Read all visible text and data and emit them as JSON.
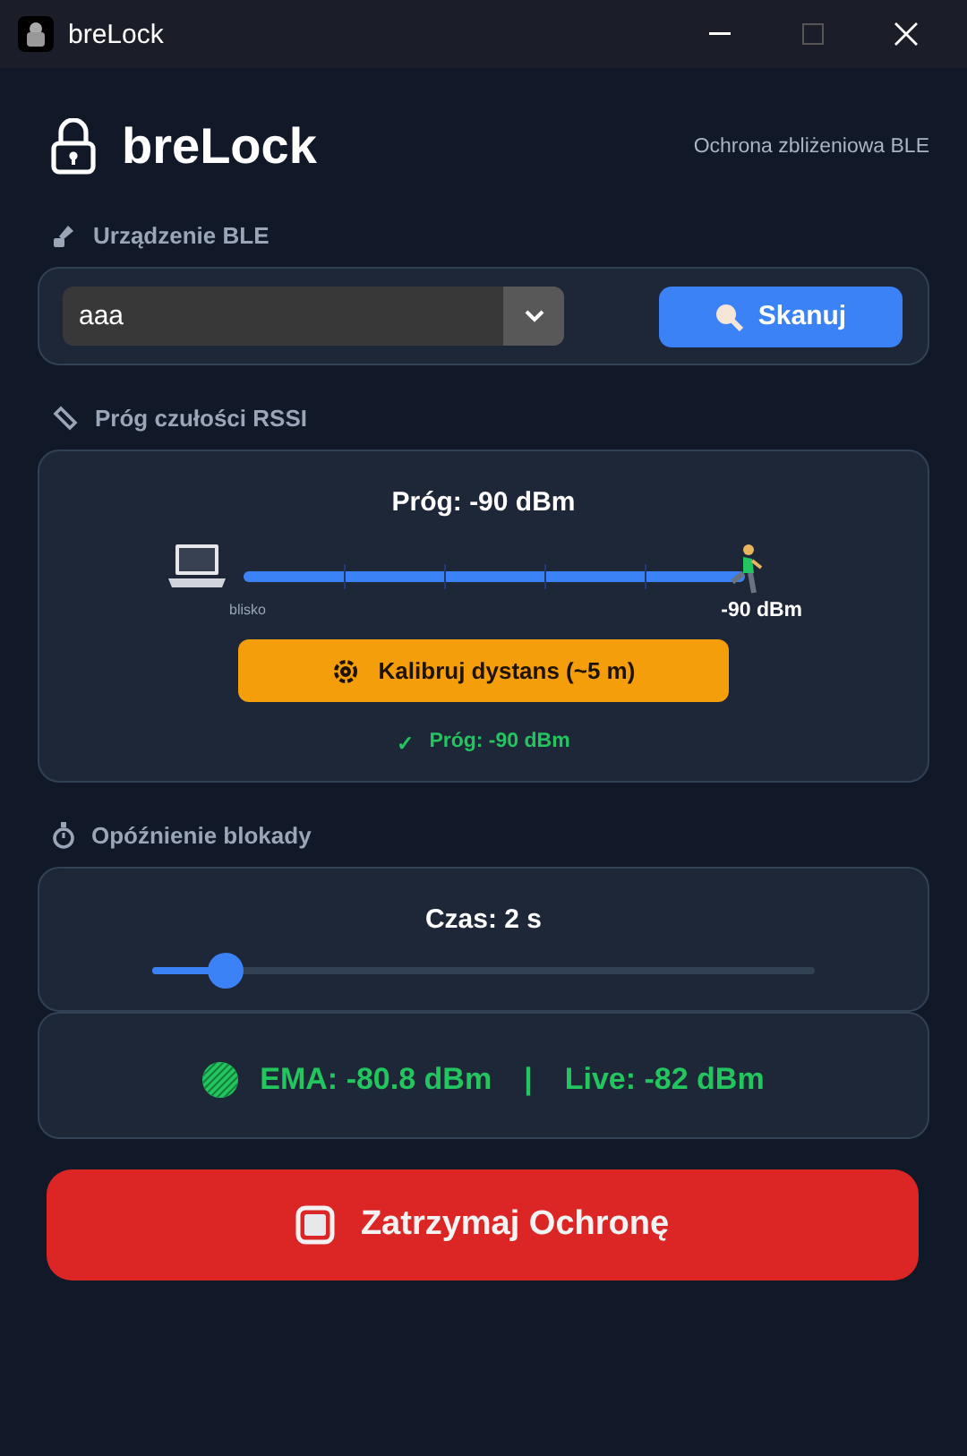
{
  "window": {
    "title": "breLock"
  },
  "header": {
    "title": "breLock",
    "subtitle": "Ochrona zbliżeniowa BLE"
  },
  "device_section": {
    "heading": "Urządzenie BLE",
    "device_select": {
      "value": "aaa"
    },
    "scan_button": "Skanuj"
  },
  "rssi_section": {
    "heading": "Próg czułości RSSI",
    "threshold_label": "Próg: -90 dBm",
    "slider": {
      "level": 1,
      "min_label": "blisko",
      "value_label": "-90 dBm"
    },
    "calibrate_button": "Kalibruj dystans (~5 m)",
    "status": {
      "mark": "✓",
      "text": "Próg: -90 dBm"
    }
  },
  "delay_section": {
    "heading": "Opóźnienie blokady",
    "time_label": "Czas: 2 s",
    "slider": {
      "level": 0.11
    }
  },
  "signal": {
    "ema": "EMA: -80.8 dBm",
    "separator": "|",
    "live": "Live: -82 dBm"
  },
  "stop_button": "Zatrzymaj Ochronę"
}
